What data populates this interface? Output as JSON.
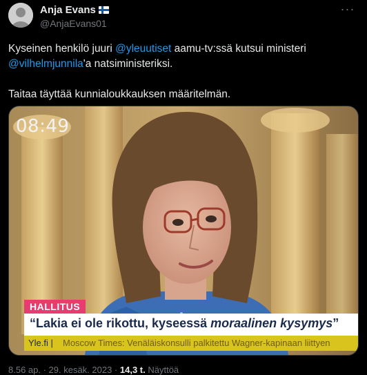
{
  "author": {
    "name": "Anja Evans",
    "handle": "@AnjaEvans01",
    "flag": "finland-flag-icon"
  },
  "tweet": {
    "line1_pre": "Kyseinen henkilö juuri ",
    "line1_mention": "@yleuutiset",
    "line1_post": " aamu-tv:ssä kutsui ministeri",
    "line2_mention": "@vilhelmjunnila",
    "line2_post": "'a natsiministeriksi.",
    "line3": "Taitaa täyttää kunnialoukkauksen määritelmän."
  },
  "media": {
    "clock": "08:49",
    "tag": "HALLITUS",
    "headline_pre": "“Lakia ei ole rikottu, kyseessä ",
    "headline_em": "moraalinen kysymys",
    "headline_post": "”",
    "ticker_source": "Yle.fi |",
    "ticker_text": "Moscow Times: Venäläiskonsulli palkitettu Wagner-kapinaan liittyen"
  },
  "meta": {
    "time": "8.56 ap. · 29. kesäk. 2023 · ",
    "views_count": "14,3 t.",
    "views_label": " Näyttöä"
  },
  "colors": {
    "background": "#000000",
    "text": "#e7e9ea",
    "secondary": "#71767b",
    "link": "#1d9bf0",
    "tag": "#e63c6f",
    "ticker": "#d9c31d"
  }
}
